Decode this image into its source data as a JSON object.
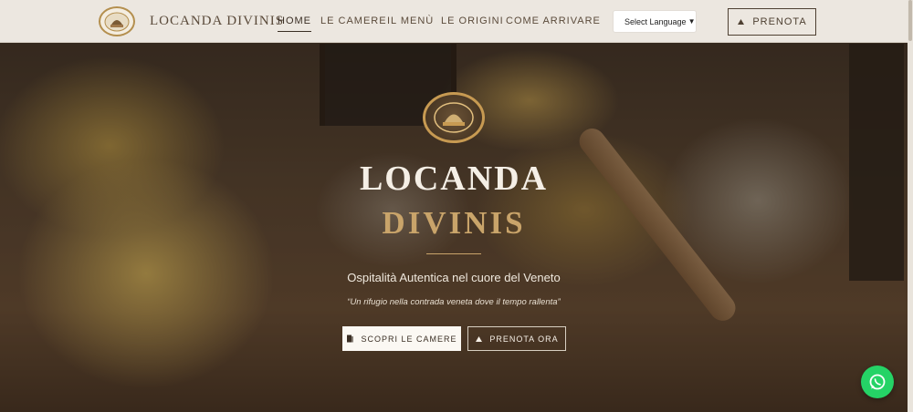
{
  "navbar": {
    "brand": "LOCANDA DIVINIS",
    "links": [
      {
        "label": "HOME",
        "active": true
      },
      {
        "label": "LE CAMERE",
        "active": false
      },
      {
        "label": "IL MENÙ",
        "active": false
      },
      {
        "label": "LE ORIGINI",
        "active": false
      },
      {
        "label": "COME ARRIVARE",
        "active": false
      }
    ],
    "language_select": "Select Language",
    "book_button": "PRENOTA"
  },
  "hero": {
    "title": "LOCANDA",
    "subtitle": "DIVINIS",
    "tagline": "Ospitalità Autentica nel cuore del Veneto",
    "quote": "“Un rifugio nella contrada veneta dove il tempo rallenta”",
    "primary_button": "SCOPRI LE CAMERE",
    "secondary_button": "PRENOTA ORA"
  },
  "colors": {
    "nav_bg": "#ece7e0",
    "gold_accent": "#c9a46a",
    "whatsapp_green": "#25d366"
  },
  "icons": {
    "book_icon": "bell-icon",
    "rooms_icon": "door-icon",
    "chat_icon": "whatsapp-icon"
  }
}
